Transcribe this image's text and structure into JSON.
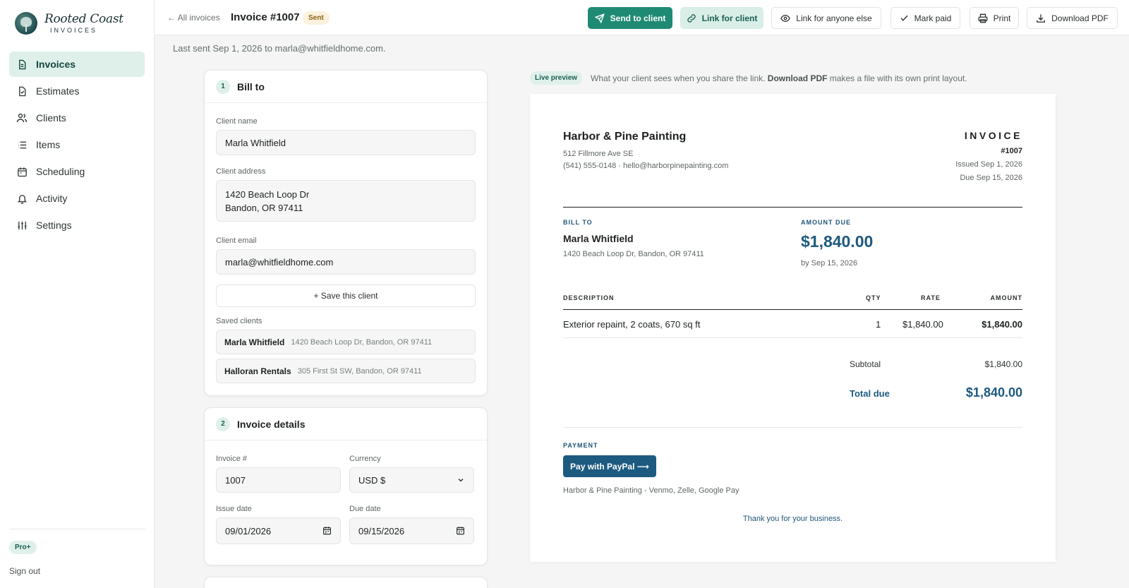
{
  "app": {
    "name": "Rooted Coast",
    "sub": "INVOICES",
    "plan": "Pro+",
    "sign_out": "Sign out"
  },
  "nav": [
    {
      "label": "Invoices",
      "icon": "file-icon"
    },
    {
      "label": "Estimates",
      "icon": "file-check-icon"
    },
    {
      "label": "Clients",
      "icon": "users-icon"
    },
    {
      "label": "Items",
      "icon": "list-icon"
    },
    {
      "label": "Scheduling",
      "icon": "calendar-icon"
    },
    {
      "label": "Activity",
      "icon": "bell-icon"
    },
    {
      "label": "Settings",
      "icon": "sliders-icon"
    }
  ],
  "topbar": {
    "back": "← All invoices",
    "title": "Invoice #1007",
    "status": "Sent",
    "send": "Send to client",
    "link_client": "Link for client",
    "link_anyone": "Link for anyone else",
    "mark_paid": "Mark paid",
    "print": "Print",
    "download": "Download PDF"
  },
  "last_sent": "Last sent Sep 1, 2026 to marla@whitfieldhome.com.",
  "bill_to": {
    "step": "1",
    "title": "Bill to",
    "name_label": "Client name",
    "name": "Marla Whitfield",
    "address_label": "Client address",
    "address_line1": "1420 Beach Loop Dr",
    "address_line2": "Bandon, OR 97411",
    "email_label": "Client email",
    "email": "marla@whitfieldhome.com",
    "save_client": "+ Save this client",
    "saved_label": "Saved clients",
    "saved": [
      {
        "name": "Marla Whitfield",
        "address": "1420 Beach Loop Dr, Bandon, OR 97411"
      },
      {
        "name": "Halloran Rentals",
        "address": "305 First St SW, Bandon, OR 97411"
      }
    ]
  },
  "details": {
    "step": "2",
    "title": "Invoice details",
    "number_label": "Invoice #",
    "number": "1007",
    "currency_label": "Currency",
    "currency": "USD $",
    "issue_label": "Issue date",
    "issue": "09/01/2026",
    "due_label": "Due date",
    "due": "09/15/2026"
  },
  "preview": {
    "badge": "Live preview",
    "note_a": "What your client sees when you share the link. ",
    "note_b": "Download PDF",
    "note_c": " makes a file with its own print layout.",
    "company": "Harbor & Pine Painting",
    "co_address": "512 Fillmore Ave SE",
    "co_contact": "(541) 555-0148 · hello@harborpinepainting.com",
    "invoice_word": "INVOICE",
    "number": "#1007",
    "issued": "Issued Sep 1, 2026",
    "due": "Due Sep 15, 2026",
    "bill_to_cap": "BILL TO",
    "client": "Marla Whitfield",
    "client_address": "1420 Beach Loop Dr, Bandon, OR 97411",
    "amount_due_cap": "AMOUNT DUE",
    "amount_due": "$1,840.00",
    "by_date": "by Sep 15, 2026",
    "cols": {
      "desc": "DESCRIPTION",
      "qty": "QTY",
      "rate": "RATE",
      "amount": "AMOUNT"
    },
    "line": {
      "desc": "Exterior repaint, 2 coats, 670 sq ft",
      "qty": "1",
      "rate": "$1,840.00",
      "amount": "$1,840.00"
    },
    "subtotal_label": "Subtotal",
    "subtotal": "$1,840.00",
    "total_label": "Total due",
    "total": "$1,840.00",
    "payment_cap": "PAYMENT",
    "pay_button": "Pay with PayPal ⟶",
    "methods": "Harbor & Pine Painting - Venmo, Zelle, Google Pay",
    "thanks": "Thank you for your business."
  },
  "colors": {
    "accent": "#1f8a74",
    "brand_navy": "#1d5a80",
    "active_nav_bg": "#dff0ea"
  }
}
